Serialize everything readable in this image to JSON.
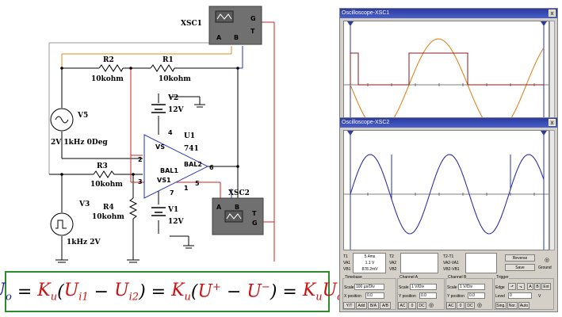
{
  "circuit": {
    "xsc1_label": "XSC1",
    "xsc2_label": "XSC2",
    "scope_pin_a": "A",
    "scope_pin_b": "B",
    "scope_pin_g": "G",
    "scope_pin_t": "T",
    "r2": {
      "name": "R2",
      "value": "10kohm"
    },
    "r1": {
      "name": "R1",
      "value": "10kohm"
    },
    "r3": {
      "name": "R3",
      "value": "10kohm"
    },
    "r4": {
      "name": "R4",
      "value": "10kohm"
    },
    "v2": {
      "name": "V2",
      "value": "12V"
    },
    "v1": {
      "name": "V1",
      "value": "12V"
    },
    "v5": {
      "name": "V5",
      "value": "2V 1kHz 0Deg"
    },
    "v3": {
      "name": "V3",
      "value": "1kHz 2V"
    },
    "u1": {
      "name": "U1",
      "model": "741",
      "pin_vs_plus": "VS",
      "pin_vs_minus": "VS1",
      "bal1": "BAL1",
      "bal2": "BAL2"
    },
    "pins": [
      "2",
      "3",
      "4",
      "5",
      "6",
      "7",
      "1"
    ]
  },
  "formula": {
    "uo": "U",
    "uo_sub": "o",
    "eq": " = ",
    "ku": "K",
    "ku_sub": "u",
    "ui1": "U",
    "ui1_sub": "i1",
    "minus": " − ",
    "ui2": "U",
    "ui2_sub": "i2",
    "uplus": "U",
    "uplus_sup": "+",
    "uminus": "U",
    "uminus_sup": "−",
    "ud": "U",
    "ud_sub": "d"
  },
  "scope1": {
    "title": "Oscilloscope-XSC1",
    "close": "x",
    "wave_colors": {
      "sine": "#e07a10",
      "square": "#8b1a1a",
      "cursor": "#2a3aa0"
    }
  },
  "scope2": {
    "title": "Oscilloscope-XSC2",
    "close": "x",
    "wave_colors": {
      "a": "#e07a10",
      "b": "#2233bb",
      "cursor": "#2a3aa0"
    },
    "t1": "T1",
    "t2": "T2",
    "t2t1": "T2-T1",
    "vb1": "VB1",
    "va1": "VA1",
    "vb2": "VB2",
    "va2": "VA2",
    "vb2vb1": "VB2-VB1",
    "va2va1": "VA2-VA1",
    "t1_time": "5.4ms",
    "t1_v1": "1.1 V",
    "t1_v2": "878.2mV",
    "reverse": "Reverse",
    "save": "Save",
    "ground": "Ground",
    "timebase": {
      "label": "Timebase",
      "scale_label": "Scale",
      "scale_value": "100 µs/Div",
      "xpos_label": "X position",
      "xpos_value": "0.0",
      "modes": [
        "Y/T",
        "Add",
        "B/A",
        "A/B"
      ]
    },
    "channel_a": {
      "label": "Channel A",
      "scale_label": "Scale",
      "scale_value": "1 V/Div",
      "ypos_label": "Y position",
      "ypos_value": "0.0",
      "coupling": [
        "AC",
        "0",
        "DC"
      ]
    },
    "channel_b": {
      "label": "Channel B",
      "scale_label": "Scale",
      "scale_value": "1 V/Div",
      "ypos_label": "Y position",
      "ypos_value": "0.0",
      "coupling": [
        "AC",
        "0",
        "DC"
      ]
    },
    "trigger": {
      "label": "Trigger",
      "edge_label": "Edge",
      "level_label": "Level",
      "level_value": "0",
      "level_unit": "V",
      "modes": [
        "Sing.",
        "Nor.",
        "Auto",
        "A",
        "B",
        "Ext"
      ]
    }
  }
}
